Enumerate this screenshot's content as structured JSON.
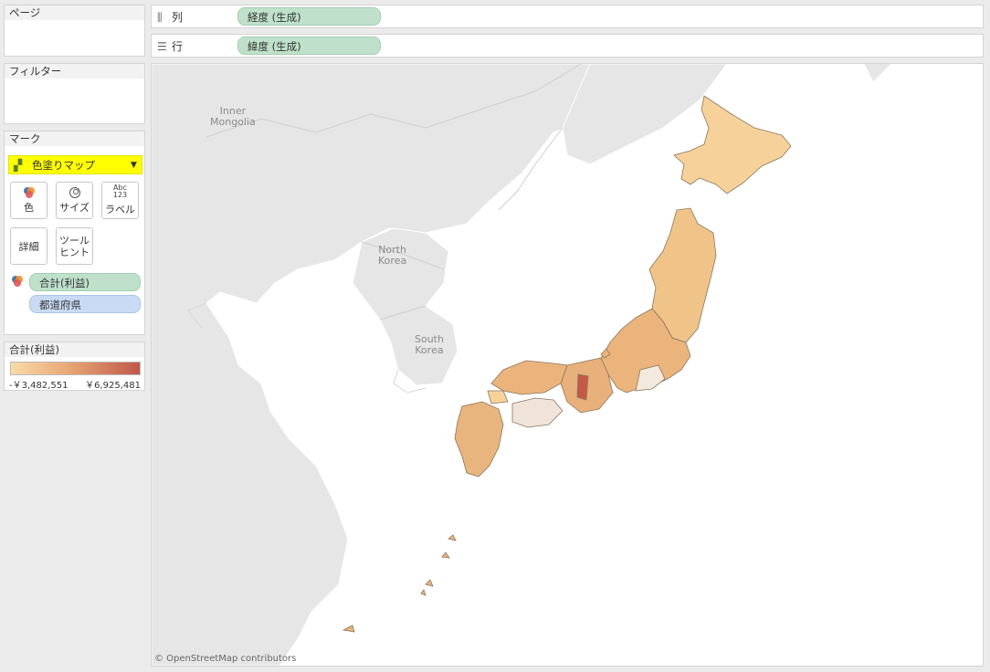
{
  "panels": {
    "pages": "ページ",
    "filters": "フィルター",
    "marks": "マーク"
  },
  "marks_card": {
    "mark_type": "色塗りマップ",
    "buttons": {
      "color": "色",
      "size": "サイズ",
      "label": "ラベル",
      "label_icon_line1": "Abc",
      "label_icon_line2": "123",
      "detail": "詳細",
      "tooltip_line1": "ツール",
      "tooltip_line2": "ヒント"
    },
    "color_field": "合計(利益)",
    "detail_field": "都道府県"
  },
  "shelves": {
    "columns_label": "列",
    "columns_pill": "経度 (生成)",
    "rows_label": "行",
    "rows_pill": "緯度 (生成)"
  },
  "legend": {
    "title": "合計(利益)",
    "min": "-￥3,482,551",
    "max": "￥6,925,481",
    "colors": {
      "low": "#f8dba8",
      "mid": "#e7a775",
      "high": "#c1574a"
    }
  },
  "map": {
    "labels": {
      "inner_mongolia_1": "Inner",
      "inner_mongolia_2": "Mongolia",
      "north_korea_1": "North",
      "north_korea_2": "Korea",
      "south_korea_1": "South",
      "south_korea_2": "Korea"
    },
    "attribution": "© OpenStreetMap contributors"
  }
}
